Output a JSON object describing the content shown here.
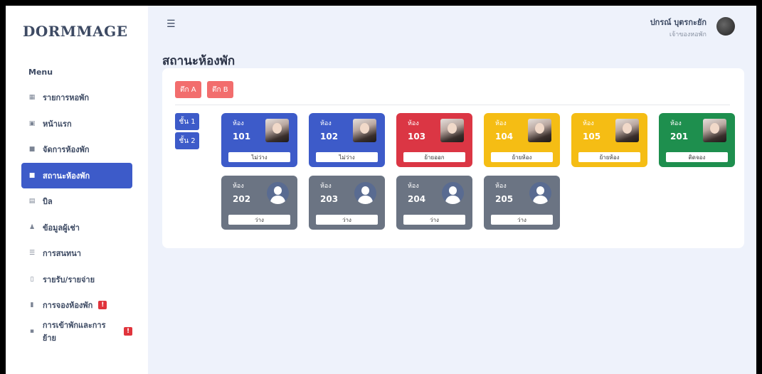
{
  "brand": "DORMMAGE",
  "sidebar": {
    "menu_heading": "Menu",
    "items": [
      {
        "label": "รายการหอพัก",
        "icon": "grid-icon",
        "glyph": "▦",
        "active": false,
        "badge": ""
      },
      {
        "label": "หน้าแรก",
        "icon": "dashboard-icon",
        "glyph": "▣",
        "active": false,
        "badge": ""
      },
      {
        "label": "จัดการห้องพัก",
        "icon": "door-icon",
        "glyph": "■",
        "active": false,
        "badge": ""
      },
      {
        "label": "สถานะห้องพัก",
        "icon": "room-status-icon",
        "glyph": "■",
        "active": true,
        "badge": ""
      },
      {
        "label": "บิล",
        "icon": "bill-icon",
        "glyph": "▤",
        "active": false,
        "badge": ""
      },
      {
        "label": "ข้อมูลผู้เช่า",
        "icon": "users-icon",
        "glyph": "♟",
        "active": false,
        "badge": ""
      },
      {
        "label": "การสนทนา",
        "icon": "chat-icon",
        "glyph": "☰",
        "active": false,
        "badge": ""
      },
      {
        "label": "รายรับ/รายจ่าย",
        "icon": "document-icon",
        "glyph": "▯",
        "active": false,
        "badge": ""
      },
      {
        "label": "การจองห้องพัก",
        "icon": "booking-icon",
        "glyph": "▮",
        "active": false,
        "badge": "!"
      },
      {
        "label": "การเข้าพักและการย้าย",
        "icon": "move-in-icon",
        "glyph": "▪",
        "active": false,
        "badge": "!"
      }
    ]
  },
  "header": {
    "menu_icon": "hamburger-icon",
    "user_name": "ปกรณ์ บุตรกะยัก",
    "user_role": "เจ้าของหอพัก"
  },
  "page_title": "สถานะห้องพัก",
  "buildings": [
    "ตึก A",
    "ตึก B"
  ],
  "floors": [
    "ชั้น 1",
    "ชั้น 2"
  ],
  "room_label": "ห้อง",
  "rooms": [
    {
      "number": "101",
      "status": "ไม่ว่าง",
      "color": "#3d5bc9",
      "photo": true
    },
    {
      "number": "102",
      "status": "ไม่ว่าง",
      "color": "#3d5bc9",
      "photo": true
    },
    {
      "number": "103",
      "status": "ย้ายออก",
      "color": "#db3644",
      "photo": true
    },
    {
      "number": "104",
      "status": "ย้ายห้อง",
      "color": "#f5bd14",
      "photo": true
    },
    {
      "number": "105",
      "status": "ย้ายห้อง",
      "color": "#f5bd14",
      "photo": true
    },
    {
      "number": "201",
      "status": "ติดจอง",
      "color": "#1e8f4e",
      "photo": true
    },
    {
      "number": "202",
      "status": "ว่าง",
      "color": "#6b7483",
      "photo": false
    },
    {
      "number": "203",
      "status": "ว่าง",
      "color": "#6b7483",
      "photo": false
    },
    {
      "number": "204",
      "status": "ว่าง",
      "color": "#6b7483",
      "photo": false
    },
    {
      "number": "205",
      "status": "ว่าง",
      "color": "#6b7483",
      "photo": false
    }
  ]
}
